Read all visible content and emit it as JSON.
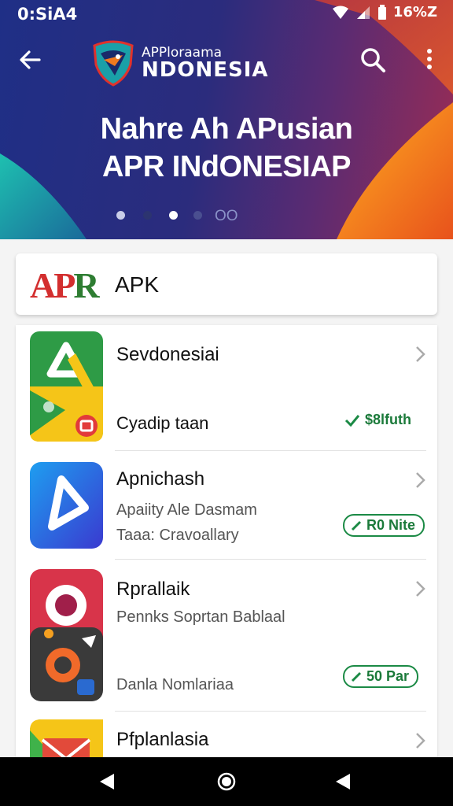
{
  "status_bar": {
    "time": "0:SiA4",
    "battery": "16%Z"
  },
  "header": {
    "brand_small": "APPloraama",
    "brand_big": "NDONESIA",
    "headline_line1": "Nahre Ah APusian",
    "headline_line2": "APR INdONESIAP",
    "dots_label": "OO",
    "active_dot": 3
  },
  "section": {
    "logo_text_1": "AP",
    "logo_text_2": "R",
    "title": "APK"
  },
  "apps": [
    {
      "title": "Sevdonesiai",
      "subtitle": "Cyadip taan",
      "price": "$8lfuth"
    },
    {
      "title": "Apnichash",
      "subtitle_1": "Apaiity Ale Dasmam",
      "subtitle_2": "Taaa: Cravoallary",
      "price": "R0 Nite"
    },
    {
      "title": "Rprallaik",
      "subtitle_1": "Pennks Soprtan Bablaal",
      "subtitle_2": "Danla Nomlariaa",
      "price": "50 Par"
    },
    {
      "title": "Pfplanlasia"
    }
  ],
  "colors": {
    "hero_blue": "#1f2f86",
    "accent_orange": "#f07a1f",
    "accent_teal": "#1aa0a8",
    "price_green": "#1b7a3a"
  }
}
